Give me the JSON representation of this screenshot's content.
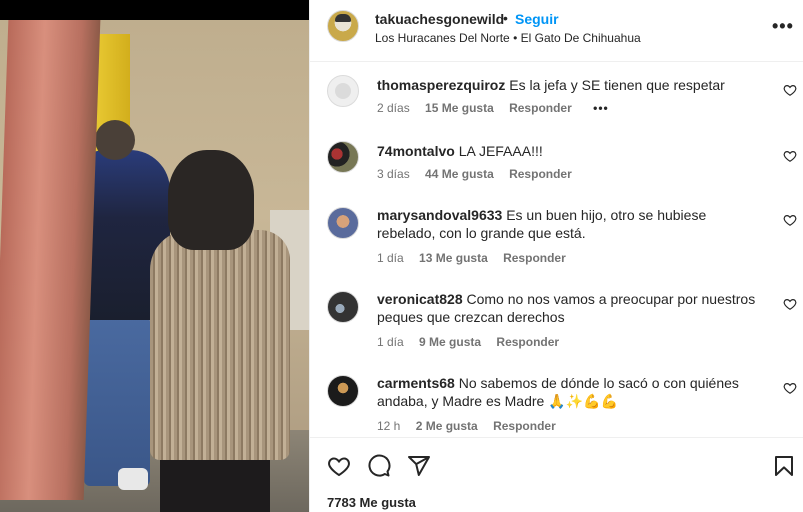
{
  "header": {
    "username": "takuachesgonewild",
    "separator": "•",
    "follow_label": "Seguir",
    "audio": "Los Huracanes Del Norte • El Gato De Chihuahua",
    "more_icon": "more-horizontal-icon"
  },
  "comments": [
    {
      "user": "thomasperezquiroz",
      "text": "Es la jefa y SE tienen que respetar",
      "time": "2 días",
      "likes": "15 Me gusta",
      "reply": "Responder",
      "more": "•••"
    },
    {
      "user": "74montalvo",
      "text": "LA JEFAAA!!!",
      "time": "3 días",
      "likes": "44 Me gusta",
      "reply": "Responder"
    },
    {
      "user": "marysandoval9633",
      "text": "Es un buen hijo, otro se hubiese rebelado, con lo grande que está.",
      "time": "1 día",
      "likes": "13 Me gusta",
      "reply": "Responder"
    },
    {
      "user": "veronicat828",
      "text": "Como no nos vamos a preocupar por nuestros peques que crezcan derechos",
      "time": "1 día",
      "likes": "9 Me gusta",
      "reply": "Responder"
    },
    {
      "user": "carments68",
      "text": "No sabemos de dónde lo sacó o con quiénes andaba, y Madre es Madre 🙏✨💪💪",
      "time": "12 h",
      "likes": "2 Me gusta",
      "reply": "Responder"
    }
  ],
  "actions": {
    "like_icon": "heart-icon",
    "comment_icon": "comment-icon",
    "share_icon": "share-icon",
    "save_icon": "bookmark-icon",
    "likes_count": "7783 Me gusta"
  }
}
